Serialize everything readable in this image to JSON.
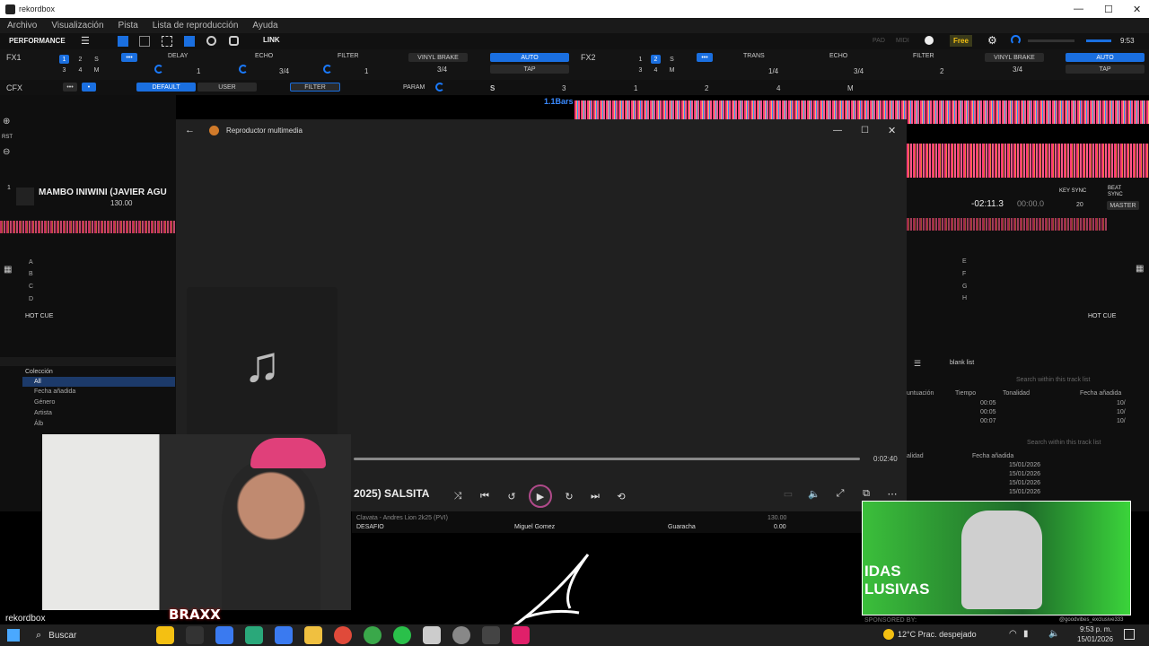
{
  "window": {
    "title": "rekordbox"
  },
  "menu": [
    "Archivo",
    "Visualización",
    "Pista",
    "Lista de reproducción",
    "Ayuda"
  ],
  "toolbar": {
    "mode": "PERFORMANCE",
    "link": "LINK",
    "pad": "PAD",
    "midi": "MIDI",
    "free": "Free",
    "time": "9:53"
  },
  "fx1": {
    "label": "FX1",
    "nums": [
      "1",
      "2",
      "S",
      "3",
      "4",
      "M"
    ],
    "effects": [
      "DELAY",
      "ECHO",
      "FILTER"
    ],
    "vinyl": "VINYL BRAKE",
    "auto": "AUTO",
    "tap": "TAP",
    "vals": [
      "1",
      "3/4",
      "1",
      "3/4"
    ]
  },
  "fx2": {
    "label": "FX2",
    "nums": [
      "1",
      "2",
      "S",
      "3",
      "4",
      "M"
    ],
    "effects": [
      "TRANS",
      "ECHO",
      "FILTER"
    ],
    "vinyl": "VINYL BRAKE",
    "auto": "AUTO",
    "tap": "TAP",
    "vals": [
      "1/4",
      "3/4",
      "2",
      "3/4"
    ]
  },
  "cfx": {
    "label": "CFX",
    "default": "DEFAULT",
    "user": "USER",
    "filter": "FILTER",
    "param": "PARAM",
    "s": "S",
    "n3": "3",
    "n1": "1",
    "n2": "2",
    "n4": "4",
    "m": "M"
  },
  "deck_left": {
    "rst": "RST",
    "num": "1",
    "track": "MAMBO INIWINI (JAVIER AGU",
    "bpm": "130.00",
    "pads": [
      "A",
      "B",
      "C",
      "D"
    ],
    "hotcue": "HOT CUE"
  },
  "deck_right": {
    "bars": "1.1Bars",
    "time": "-02:11.3",
    "time2": "00:00.0",
    "keysync": "KEY SYNC",
    "beatsync": "BEAT SYNC",
    "master": "MASTER",
    "pads": [
      "E",
      "F",
      "G",
      "H"
    ],
    "hotcue": "HOT CUE",
    "val": "20"
  },
  "browser": {
    "coleccion": "Colección",
    "all": "All",
    "items": [
      "Fecha añadida",
      "Género",
      "Artista",
      "Álb"
    ]
  },
  "tracklist_right": {
    "listname": "blank list",
    "search": "Search within this track list",
    "cols": [
      "untuación",
      "Tiempo",
      "Tonalidad",
      "Fecha añadida"
    ],
    "rows": [
      {
        "t": "00:05",
        "f": "10/"
      },
      {
        "t": "00:05",
        "f": "10/"
      },
      {
        "t": "00:07",
        "f": "10/"
      }
    ],
    "search2": "Search within this track list",
    "cols2": [
      "alidad",
      "Fecha añadida"
    ],
    "dates": [
      "15/01/2026",
      "15/01/2026",
      "15/01/2026",
      "15/01/2026"
    ]
  },
  "player": {
    "title": "Reproductor multimedia",
    "song": "2025) SALSITA",
    "duration": "0:02:40",
    "progress": 0
  },
  "bottom_rows": [
    {
      "title": "Clavata - Andres Lion 2k25 (PVI)",
      "artist": "",
      "genre": "",
      "bpm": "130.00"
    },
    {
      "title": "DESAFIO",
      "artist": "Miguel Gomez",
      "genre": "Guaracha",
      "bpm": "0.00"
    }
  ],
  "overlay": {
    "logo": "rekordbox",
    "ad1": "IDAS",
    "ad2": "LUSIVAS",
    "sponsor": "SPONSORED BY:",
    "handle": "@goodvibes_exclusive333",
    "brand": "BRAXX"
  },
  "taskbar": {
    "search": "Buscar",
    "weather": "12°C  Prac. despejado",
    "clock": "9:53 p. m.",
    "date": "15/01/2026"
  },
  "colors": {
    "accent": "#1a6fe0",
    "wave": "#ff3a78",
    "free": "#f4c012"
  }
}
